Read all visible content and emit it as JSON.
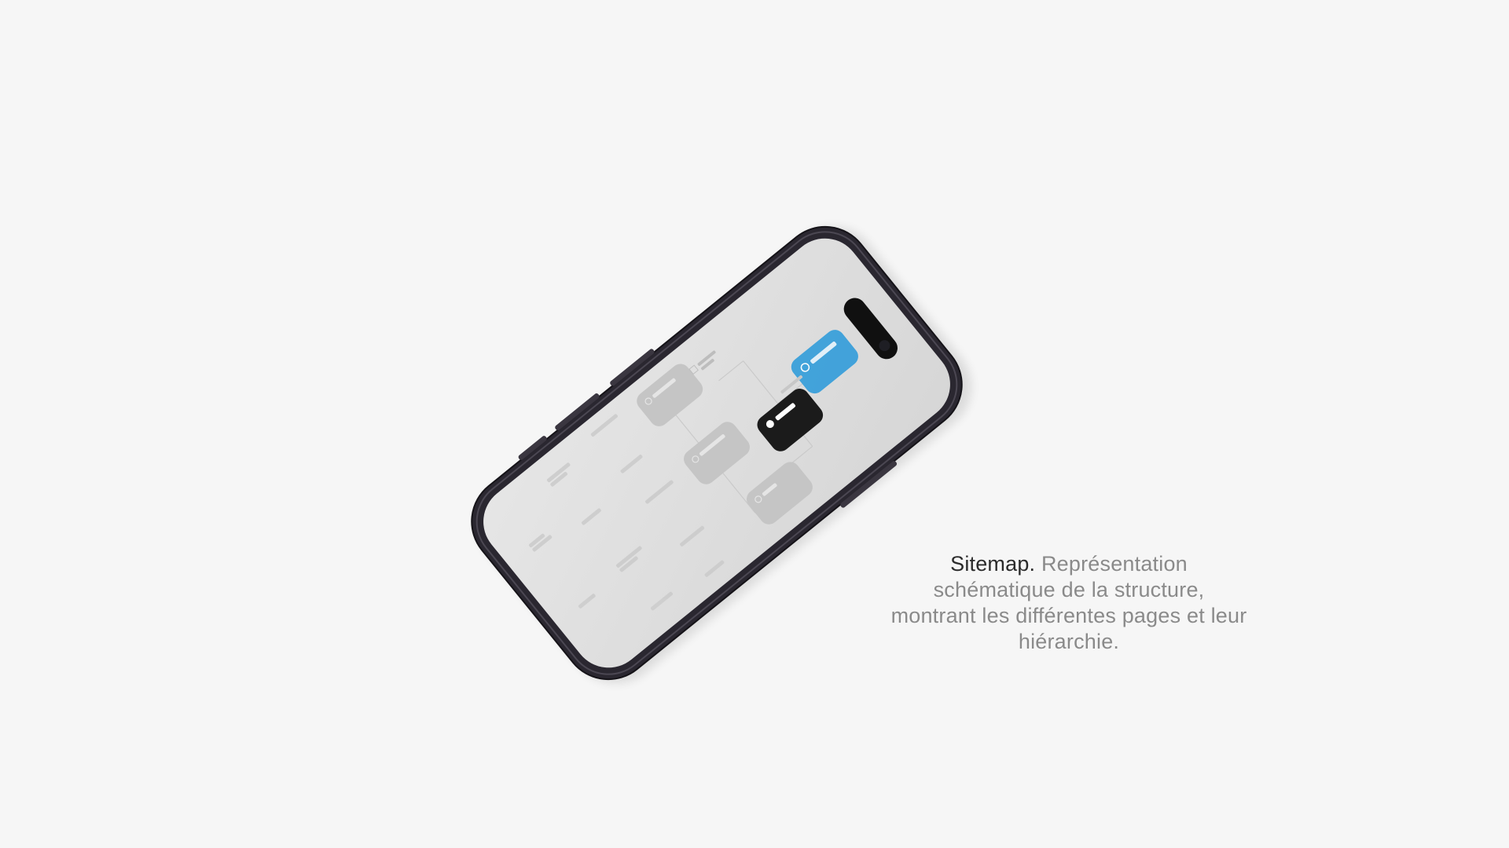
{
  "caption": {
    "lead": "Sitemap.",
    "body": "Représentation schématique de la structure, montrant les différentes pages et leur hiérarchie."
  },
  "phone": {
    "frame_color": "#2a2730",
    "screen_color": "#dedede",
    "sitemap": {
      "nodes": [
        {
          "id": "root",
          "color": "#3aa0da"
        },
        {
          "id": "accueil",
          "color": "#111111"
        },
        {
          "id": "cat-a",
          "color": "#c4c4c4"
        },
        {
          "id": "cat-b",
          "color": "#c4c4c4"
        },
        {
          "id": "cat-c",
          "color": "#c4c4c4"
        }
      ]
    }
  }
}
